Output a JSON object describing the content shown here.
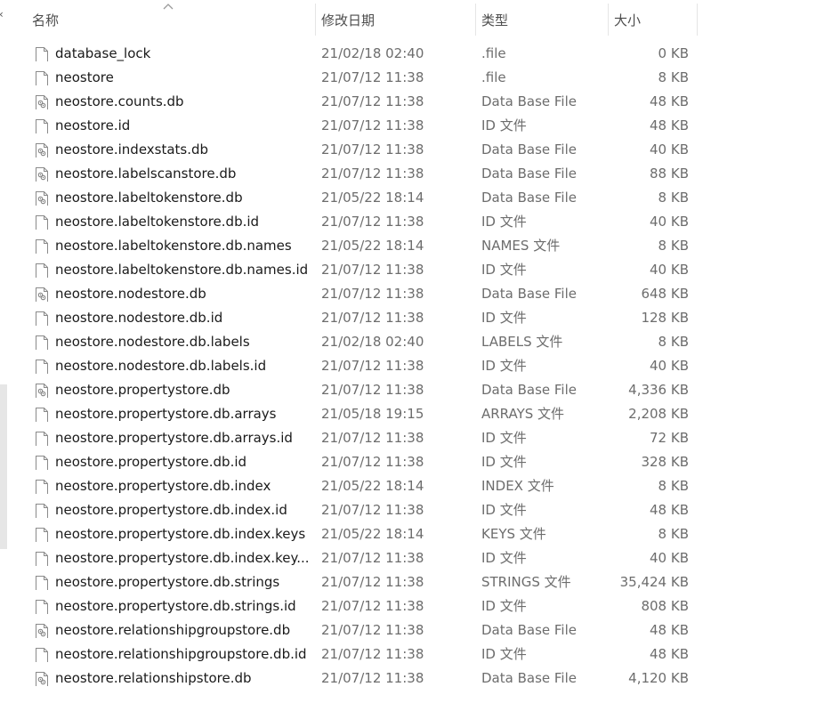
{
  "columns": {
    "name": "名称",
    "date": "修改日期",
    "type": "类型",
    "size": "大小"
  },
  "icons": {
    "plain": "blank-file-icon",
    "db": "database-file-icon"
  },
  "files": [
    {
      "name": "database_lock",
      "date": "21/02/18 02:40",
      "type": ".file",
      "size": "0 KB",
      "icon": "plain"
    },
    {
      "name": "neostore",
      "date": "21/07/12 11:38",
      "type": ".file",
      "size": "8 KB",
      "icon": "plain"
    },
    {
      "name": "neostore.counts.db",
      "date": "21/07/12 11:38",
      "type": "Data Base File",
      "size": "48 KB",
      "icon": "db"
    },
    {
      "name": "neostore.id",
      "date": "21/07/12 11:38",
      "type": "ID 文件",
      "size": "48 KB",
      "icon": "plain"
    },
    {
      "name": "neostore.indexstats.db",
      "date": "21/07/12 11:38",
      "type": "Data Base File",
      "size": "40 KB",
      "icon": "db"
    },
    {
      "name": "neostore.labelscanstore.db",
      "date": "21/07/12 11:38",
      "type": "Data Base File",
      "size": "88 KB",
      "icon": "db"
    },
    {
      "name": "neostore.labeltokenstore.db",
      "date": "21/05/22 18:14",
      "type": "Data Base File",
      "size": "8 KB",
      "icon": "db"
    },
    {
      "name": "neostore.labeltokenstore.db.id",
      "date": "21/07/12 11:38",
      "type": "ID 文件",
      "size": "40 KB",
      "icon": "plain"
    },
    {
      "name": "neostore.labeltokenstore.db.names",
      "date": "21/05/22 18:14",
      "type": "NAMES 文件",
      "size": "8 KB",
      "icon": "plain"
    },
    {
      "name": "neostore.labeltokenstore.db.names.id",
      "date": "21/07/12 11:38",
      "type": "ID 文件",
      "size": "40 KB",
      "icon": "plain"
    },
    {
      "name": "neostore.nodestore.db",
      "date": "21/07/12 11:38",
      "type": "Data Base File",
      "size": "648 KB",
      "icon": "db"
    },
    {
      "name": "neostore.nodestore.db.id",
      "date": "21/07/12 11:38",
      "type": "ID 文件",
      "size": "128 KB",
      "icon": "plain"
    },
    {
      "name": "neostore.nodestore.db.labels",
      "date": "21/02/18 02:40",
      "type": "LABELS 文件",
      "size": "8 KB",
      "icon": "plain"
    },
    {
      "name": "neostore.nodestore.db.labels.id",
      "date": "21/07/12 11:38",
      "type": "ID 文件",
      "size": "40 KB",
      "icon": "plain"
    },
    {
      "name": "neostore.propertystore.db",
      "date": "21/07/12 11:38",
      "type": "Data Base File",
      "size": "4,336 KB",
      "icon": "db"
    },
    {
      "name": "neostore.propertystore.db.arrays",
      "date": "21/05/18 19:15",
      "type": "ARRAYS 文件",
      "size": "2,208 KB",
      "icon": "plain"
    },
    {
      "name": "neostore.propertystore.db.arrays.id",
      "date": "21/07/12 11:38",
      "type": "ID 文件",
      "size": "72 KB",
      "icon": "plain"
    },
    {
      "name": "neostore.propertystore.db.id",
      "date": "21/07/12 11:38",
      "type": "ID 文件",
      "size": "328 KB",
      "icon": "plain"
    },
    {
      "name": "neostore.propertystore.db.index",
      "date": "21/05/22 18:14",
      "type": "INDEX 文件",
      "size": "8 KB",
      "icon": "plain"
    },
    {
      "name": "neostore.propertystore.db.index.id",
      "date": "21/07/12 11:38",
      "type": "ID 文件",
      "size": "48 KB",
      "icon": "plain"
    },
    {
      "name": "neostore.propertystore.db.index.keys",
      "date": "21/05/22 18:14",
      "type": "KEYS 文件",
      "size": "8 KB",
      "icon": "plain"
    },
    {
      "name": "neostore.propertystore.db.index.key...",
      "date": "21/07/12 11:38",
      "type": "ID 文件",
      "size": "40 KB",
      "icon": "plain"
    },
    {
      "name": "neostore.propertystore.db.strings",
      "date": "21/07/12 11:38",
      "type": "STRINGS 文件",
      "size": "35,424 KB",
      "icon": "plain"
    },
    {
      "name": "neostore.propertystore.db.strings.id",
      "date": "21/07/12 11:38",
      "type": "ID 文件",
      "size": "808 KB",
      "icon": "plain"
    },
    {
      "name": "neostore.relationshipgroupstore.db",
      "date": "21/07/12 11:38",
      "type": "Data Base File",
      "size": "48 KB",
      "icon": "db"
    },
    {
      "name": "neostore.relationshipgroupstore.db.id",
      "date": "21/07/12 11:38",
      "type": "ID 文件",
      "size": "48 KB",
      "icon": "plain"
    },
    {
      "name": "neostore.relationshipstore.db",
      "date": "21/07/12 11:38",
      "type": "Data Base File",
      "size": "4,120 KB",
      "icon": "db"
    }
  ]
}
